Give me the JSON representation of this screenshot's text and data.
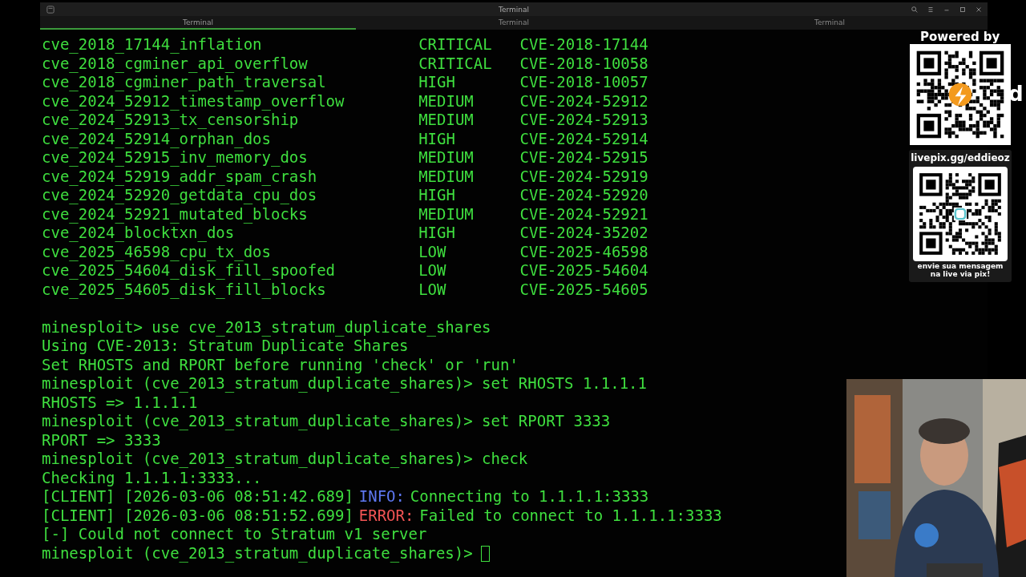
{
  "window": {
    "title": "Terminal"
  },
  "tabs": [
    {
      "label": "Terminal",
      "selected": true
    },
    {
      "label": "Terminal",
      "selected": false
    },
    {
      "label": "Terminal",
      "selected": false
    }
  ],
  "modules": [
    {
      "name": "cve_2018_17144_inflation",
      "severity": "CRITICAL",
      "cve": "CVE-2018-17144"
    },
    {
      "name": "cve_2018_cgminer_api_overflow",
      "severity": "CRITICAL",
      "cve": "CVE-2018-10058"
    },
    {
      "name": "cve_2018_cgminer_path_traversal",
      "severity": "HIGH",
      "cve": "CVE-2018-10057"
    },
    {
      "name": "cve_2024_52912_timestamp_overflow",
      "severity": "MEDIUM",
      "cve": "CVE-2024-52912"
    },
    {
      "name": "cve_2024_52913_tx_censorship",
      "severity": "MEDIUM",
      "cve": "CVE-2024-52913"
    },
    {
      "name": "cve_2024_52914_orphan_dos",
      "severity": "HIGH",
      "cve": "CVE-2024-52914"
    },
    {
      "name": "cve_2024_52915_inv_memory_dos",
      "severity": "MEDIUM",
      "cve": "CVE-2024-52915"
    },
    {
      "name": "cve_2024_52919_addr_spam_crash",
      "severity": "MEDIUM",
      "cve": "CVE-2024-52919"
    },
    {
      "name": "cve_2024_52920_getdata_cpu_dos",
      "severity": "HIGH",
      "cve": "CVE-2024-52920"
    },
    {
      "name": "cve_2024_52921_mutated_blocks",
      "severity": "MEDIUM",
      "cve": "CVE-2024-52921"
    },
    {
      "name": "cve_2024_blocktxn_dos",
      "severity": "HIGH",
      "cve": "CVE-2024-35202"
    },
    {
      "name": "cve_2025_46598_cpu_tx_dos",
      "severity": "LOW",
      "cve": "CVE-2025-46598"
    },
    {
      "name": "cve_2025_54604_disk_fill_spoofed",
      "severity": "LOW",
      "cve": "CVE-2025-54604"
    },
    {
      "name": "cve_2025_54605_disk_fill_blocks",
      "severity": "LOW",
      "cve": "CVE-2025-54605"
    }
  ],
  "lines": [
    {
      "kind": "command",
      "text": "minesploit> use cve_2013_stratum_duplicate_shares"
    },
    {
      "kind": "output",
      "text": "Using CVE-2013: Stratum Duplicate Shares"
    },
    {
      "kind": "output",
      "text": "Set RHOSTS and RPORT before running 'check' or 'run'"
    },
    {
      "kind": "command",
      "text": "minesploit (cve_2013_stratum_duplicate_shares)> set RHOSTS 1.1.1.1"
    },
    {
      "kind": "output",
      "text": "RHOSTS => 1.1.1.1"
    },
    {
      "kind": "command",
      "text": "minesploit (cve_2013_stratum_duplicate_shares)> set RPORT 3333"
    },
    {
      "kind": "output",
      "text": "RPORT => 3333"
    },
    {
      "kind": "command",
      "text": "minesploit (cve_2013_stratum_duplicate_shares)> check"
    },
    {
      "kind": "output",
      "text": "Checking 1.1.1.1:3333..."
    },
    {
      "kind": "log",
      "prefix": "[CLIENT] [2026-03-06 08:51:42.689]",
      "level": {
        "kind": "info",
        "text": "INFO:"
      },
      "message": "Connecting to 1.1.1.1:3333"
    },
    {
      "kind": "log",
      "prefix": "[CLIENT] [2026-03-06 08:51:52.699]",
      "level": {
        "kind": "error",
        "text": "ERROR:"
      },
      "message": "Failed to connect to 1.1.1.1:3333"
    },
    {
      "kind": "output",
      "text": "[-] Could not connect to Stratum v1 server"
    },
    {
      "kind": "command",
      "text": "minesploit (cve_2013_stratum_duplicate_shares)>",
      "cursor": true
    }
  ],
  "overlay": {
    "powered_by": "Powered by",
    "partial_label": "d",
    "pix_url": "livepix.gg/eddieoz",
    "pix_caption": "envie sua mensagem na live via pix!"
  }
}
